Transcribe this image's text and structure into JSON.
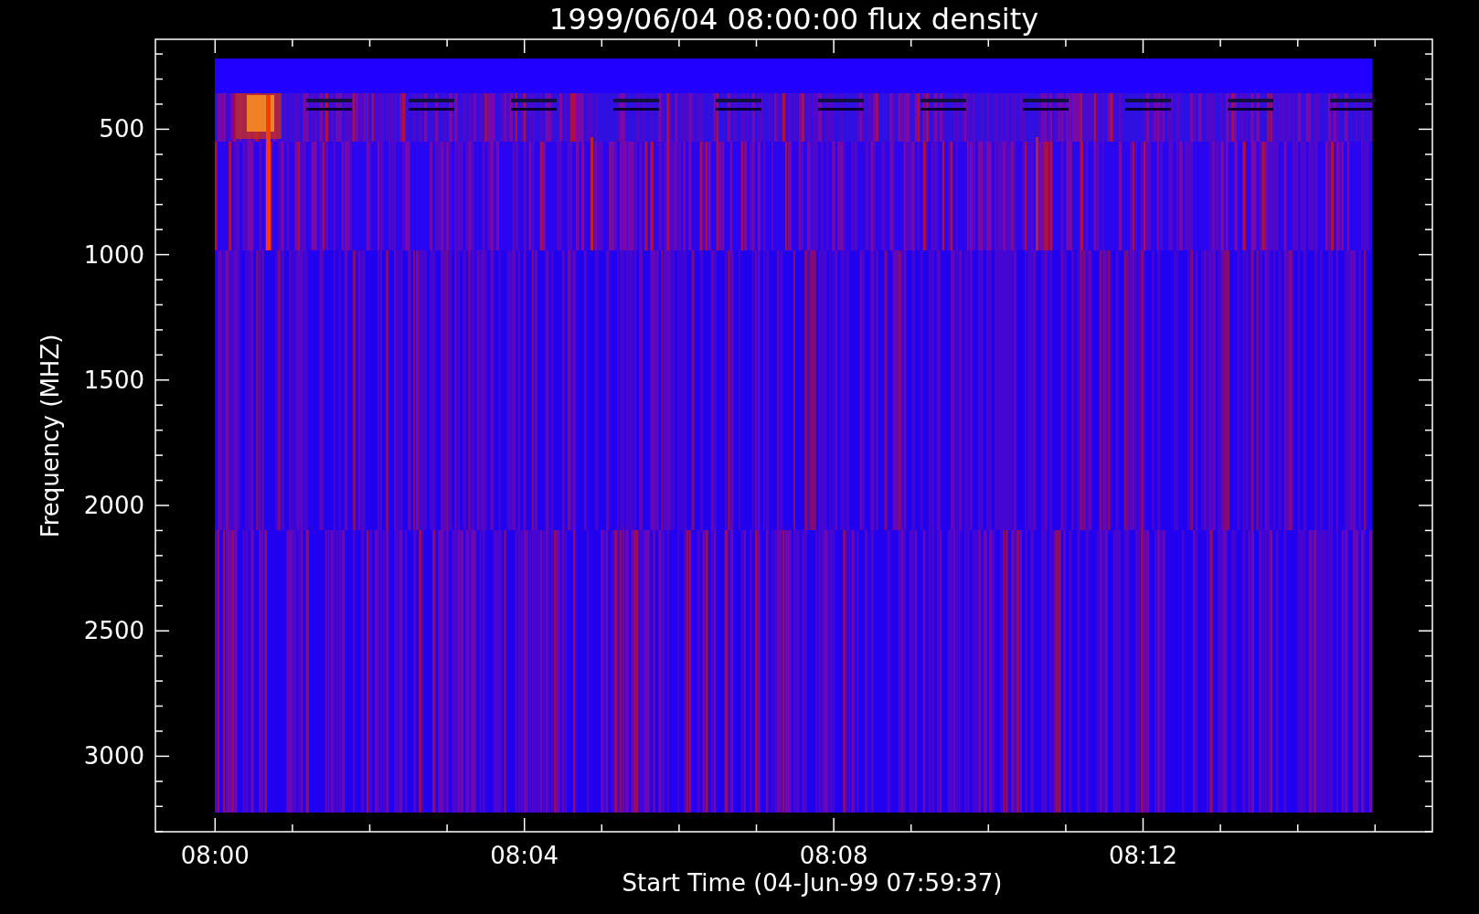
{
  "title": "1999/06/04 08:00:00 flux density",
  "y_axis": {
    "label": "Frequency (MHZ)",
    "ticks": [
      "500",
      "1000",
      "1500",
      "2000",
      "2500",
      "3000"
    ]
  },
  "x_axis": {
    "label": "Start Time (04-Jun-99 07:59:37)",
    "ticks": [
      "08:00",
      "08:04",
      "08:08",
      "08:12"
    ]
  }
}
